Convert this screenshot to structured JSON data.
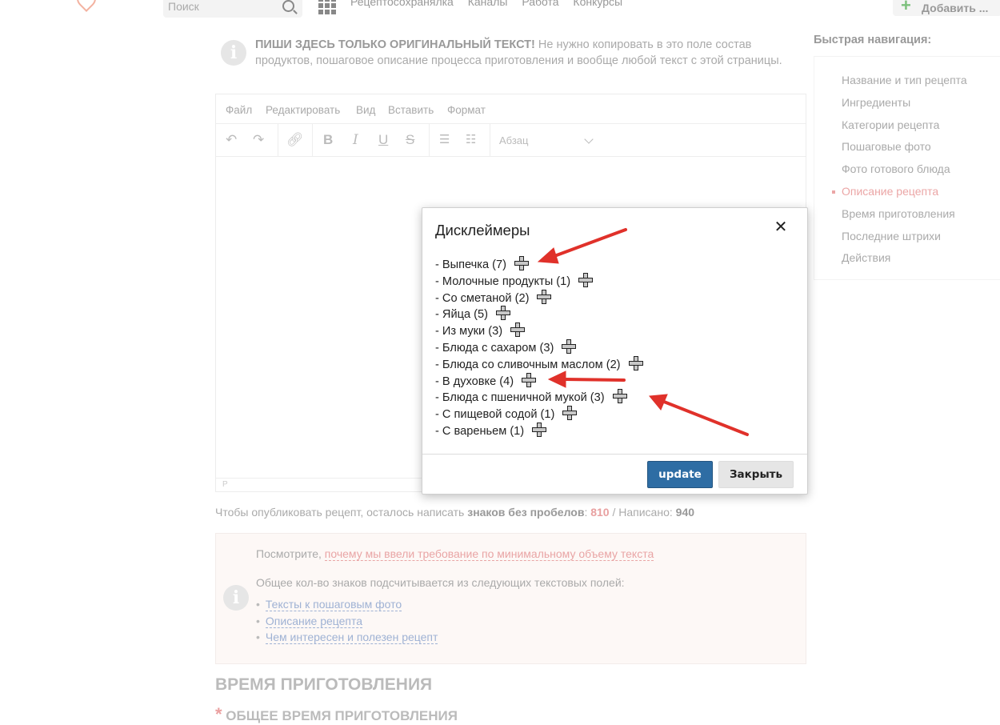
{
  "header": {
    "search_placeholder": "Поиск",
    "nav": [
      "Рецептосохранялка",
      "Каналы",
      "Работа",
      "Конкурсы"
    ],
    "add_label": "Добавить ..."
  },
  "notice": {
    "bold": "ПИШИ ЗДЕСЬ ТОЛЬКО ОРИГИНАЛЬНЫЙ ТЕКСТ!",
    "text": " Не нужно копировать в это поле состав продуктов, пошаговое описание процесса приготовления и вообще любой текст с этой страницы."
  },
  "editor": {
    "menu": [
      "Файл",
      "Редактировать",
      "Вид",
      "Вставить",
      "Формат"
    ],
    "block_format": "Абзац",
    "status_path": "P"
  },
  "counter": {
    "prefix": "Чтобы опубликовать рецепт, осталось написать ",
    "label": "знаков без пробелов",
    "remaining": "810",
    "written_label": " / Написано: ",
    "written": "940"
  },
  "info_box": {
    "line1_prefix": "Посмотрите, ",
    "line1_link": "почему мы ввели требование по минимальному объему текста",
    "line2": "Общее кол-во знаков подсчитывается из следующих текстовых полей:",
    "fields": [
      "Тексты к пошаговым фото",
      "Описание рецепта",
      "Чем интересен и полезен рецепт"
    ]
  },
  "section": {
    "title": "ВРЕМЯ ПРИГОТОВЛЕНИЯ",
    "required_mark": "*",
    "subtitle": "ОБЩЕЕ ВРЕМЯ ПРИГОТОВЛЕНИЯ"
  },
  "quick_nav": {
    "title": "Быстрая навигация:",
    "items": [
      "Название и тип рецепта",
      "Ингредиенты",
      "Категории рецепта",
      "Пошаговые фото",
      "Фото готового блюда",
      "Описание рецепта",
      "Время приготовления",
      "Последние штрихи",
      "Действия"
    ],
    "active": "Описание рецепта"
  },
  "modal": {
    "title": "Дисклеймеры",
    "close_glyph": "✕",
    "items": [
      "- Выпечка (7)",
      "- Молочные продукты (1)",
      "- Со сметаной (2)",
      "- Яйца (5)",
      "- Из муки (3)",
      "- Блюда с сахаром (3)",
      "- Блюда со сливочным маслом (2)",
      "- В духовке (4)",
      "- Блюда с пшеничной мукой (3)",
      "- С пищевой содой (1)",
      "- С вареньем (1)"
    ],
    "update_label": "update",
    "close_label": "Закрыть"
  },
  "colors": {
    "annotation_arrow": "#e0312a",
    "primary_button": "#2e6da4",
    "active_nav": "#eba6a6"
  },
  "icons": [
    "plus-icon",
    "close-icon",
    "info-icon",
    "search-icon",
    "grid-icon",
    "undo-icon",
    "redo-icon",
    "link-icon",
    "bold-icon",
    "italic-icon",
    "underline-icon",
    "strikethrough-icon",
    "bullet-list-icon",
    "numbered-list-icon",
    "chevron-down-icon"
  ]
}
